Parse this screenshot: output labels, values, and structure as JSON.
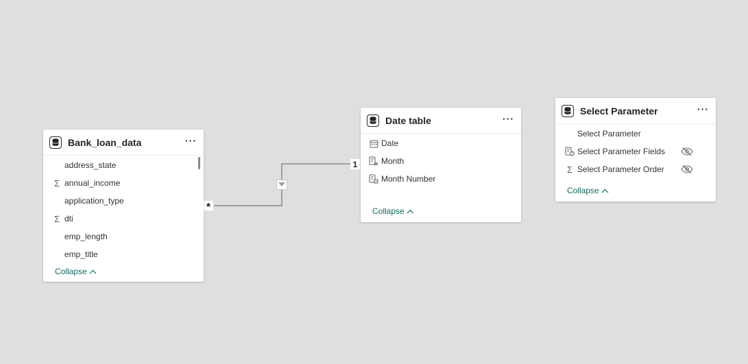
{
  "tables": {
    "bank_loan": {
      "title": "Bank_loan_data",
      "fields": [
        {
          "name": "address_state",
          "icon": "none"
        },
        {
          "name": "annual_income",
          "icon": "sigma-icon"
        },
        {
          "name": "application_type",
          "icon": "none"
        },
        {
          "name": "dti",
          "icon": "sigma-icon"
        },
        {
          "name": "emp_length",
          "icon": "none"
        },
        {
          "name": "emp_title",
          "icon": "none"
        }
      ],
      "collapse_label": "Collapse"
    },
    "date_table": {
      "title": "Date table",
      "fields": [
        {
          "name": "Date",
          "icon": "calendar-icon"
        },
        {
          "name": "Month",
          "icon": "calculated-column-icon"
        },
        {
          "name": "Month Number",
          "icon": "calculated-column-icon"
        }
      ],
      "collapse_label": "Collapse"
    },
    "select_parameter": {
      "title": "Select Parameter",
      "fields": [
        {
          "name": "Select Parameter",
          "icon": "none",
          "hidden": false
        },
        {
          "name": "Select Parameter Fields",
          "icon": "field-parameter-icon",
          "hidden": true
        },
        {
          "name": "Select Parameter Order",
          "icon": "sigma-icon",
          "hidden": true
        }
      ],
      "collapse_label": "Collapse"
    }
  },
  "relationship": {
    "many_side": "*",
    "one_side": "1",
    "filter_direction": "single"
  },
  "colors": {
    "canvas": "#e1dfdd",
    "accent": "#0f6b5b",
    "line": "#8a8886"
  }
}
